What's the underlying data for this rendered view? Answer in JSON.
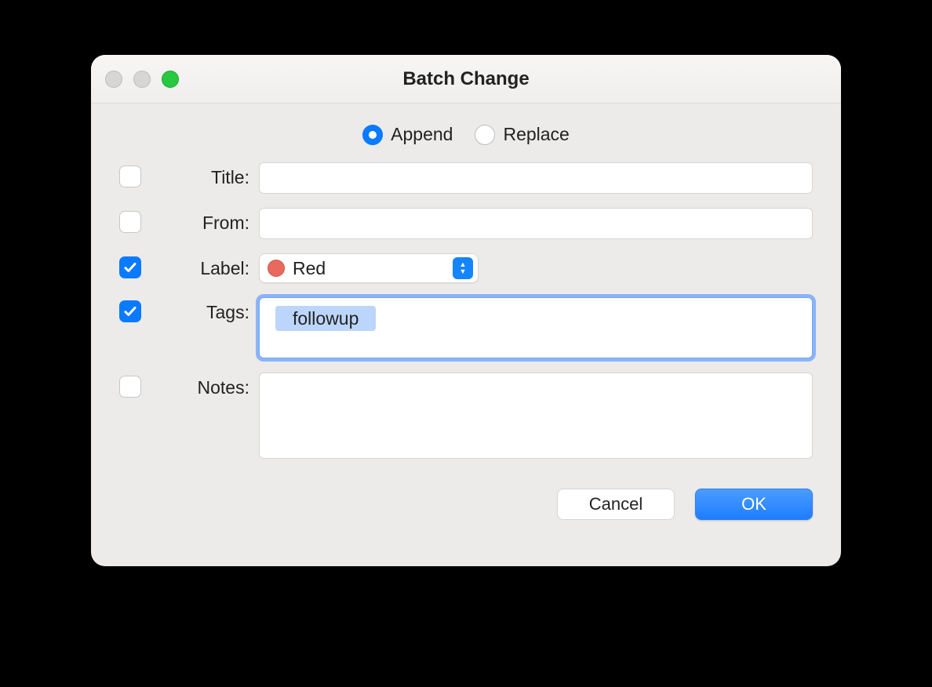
{
  "window": {
    "title": "Batch Change"
  },
  "mode": {
    "options": [
      {
        "label": "Append",
        "selected": true
      },
      {
        "label": "Replace",
        "selected": false
      }
    ]
  },
  "fields": {
    "title": {
      "label": "Title:",
      "checked": false,
      "value": ""
    },
    "from": {
      "label": "From:",
      "checked": false,
      "value": ""
    },
    "label": {
      "label": "Label:",
      "checked": true,
      "value": "Red",
      "color": "#e96a5c"
    },
    "tags": {
      "label": "Tags:",
      "checked": true,
      "chips": [
        "followup"
      ],
      "focused": true
    },
    "notes": {
      "label": "Notes:",
      "checked": false,
      "value": ""
    }
  },
  "buttons": {
    "cancel": "Cancel",
    "ok": "OK"
  }
}
